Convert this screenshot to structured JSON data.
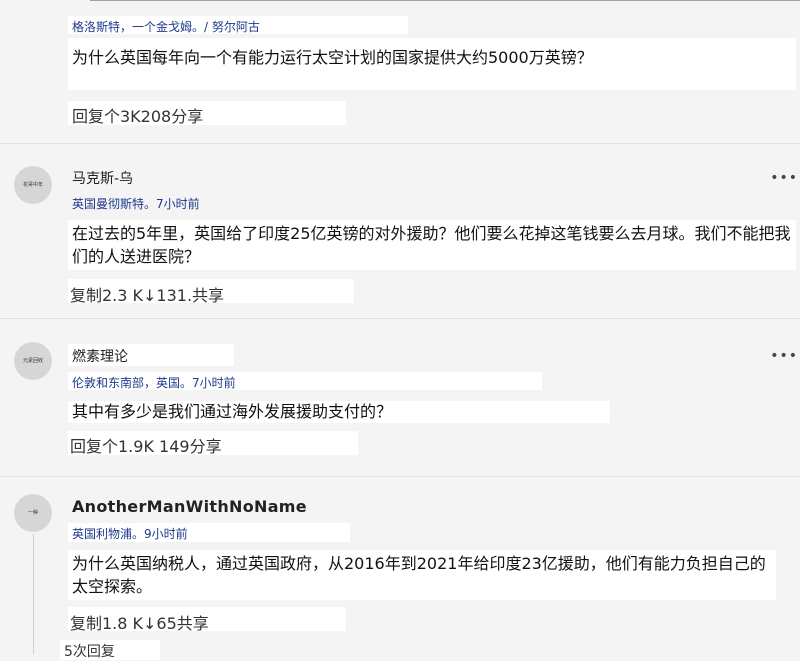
{
  "comments": [
    {
      "name": "",
      "meta": "格洛斯特，一个金戈姆。/ 努尔阿古",
      "body": "为什么英国每年向一个有能力运行太空计划的国家提供大约5000万英镑？",
      "actions": "回复个3K208分享"
    },
    {
      "avatar_text": "花哥中年",
      "name": "马克斯-乌",
      "meta": "英国曼彻斯特。7小时前",
      "body": "在过去的5年里，英国给了印度25亿英镑的对外援助？他们要么花掉这笔钱要么去月球。我们不能把我们的人送进医院？",
      "actions": "复制2.3 K↓131.共享"
    },
    {
      "avatar_text": "元素回收",
      "name": "燃素理论",
      "meta": "伦敦和东南部，英国。7小时前",
      "body": "其中有多少是我们通过海外发展援助支付的？",
      "actions": "回复个1.9K 149分享"
    },
    {
      "avatar_text": "一种",
      "name": "AnotherManWithNoName",
      "meta": "英国利物浦。9小时前",
      "body": "为什么英国纳税人，通过英国政府，从2016年到2021年给印度23亿援助，他们有能力负担自己的太空探索。",
      "actions": "复制1.8 K↓65共享",
      "replies": "5次回复"
    }
  ],
  "more_icon": "•••"
}
